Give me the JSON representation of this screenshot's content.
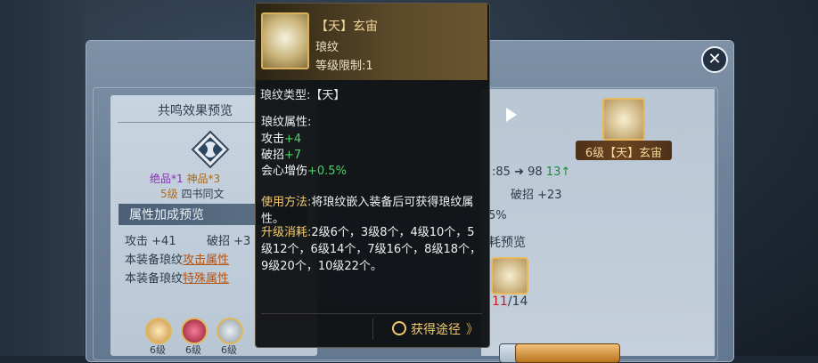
{
  "window": {
    "close_glyph": "✕"
  },
  "resonance": {
    "title": "共鸣效果预览",
    "quality_a": "绝品*1",
    "quality_b": "神品*3",
    "level_prefix": "5级",
    "level_name": "四书同文"
  },
  "attr_preview": {
    "title": "属性加成预览",
    "atk_label": "攻击",
    "atk_value": "+41",
    "brk_label": "破招",
    "brk_value": "+3",
    "equip_row1_prefix": "本装备琅纹",
    "equip_row1_link": "攻击属性",
    "equip_row2_prefix": "本装备琅纹",
    "equip_row2_link": "特殊属性"
  },
  "gem_slots": [
    {
      "level": "6级",
      "icon": "gold-gem-icon"
    },
    {
      "level": "6级",
      "icon": "red-gem-icon"
    },
    {
      "level": "6级",
      "icon": "silver-gem-icon"
    }
  ],
  "upgrade_target": {
    "name": "6级【天】玄宙",
    "stat_from": ":85",
    "stat_to": "98",
    "stat_delta": "13",
    "brk_text": "破招 +23",
    "pct_text": "5%",
    "consume_title": "耗预览",
    "consume_have": "11",
    "consume_need": "/14"
  },
  "tooltip": {
    "name": "【天】玄宙",
    "type": "琅纹",
    "level_limit": "等级限制:1",
    "cut_text": "琅纹类型:【天】",
    "attr_title": "琅纹属性:",
    "atk_label": "攻击",
    "atk_value": "+4",
    "brk_label": "破招",
    "brk_value": "+7",
    "crit_label": "会心增伤",
    "crit_value": "+0.5%",
    "usage_label": "使用方法:",
    "usage_text": "将琅纹嵌入装备后可获得琅纹属性。",
    "upgrade_label": "升级消耗:",
    "upgrade_text": "2级6个，3级8个，4级10个，5级12个，6级14个，7级16个，8级18个，9级20个，10级22个。",
    "obtain_label": "获得途径",
    "obtain_arrow": "》"
  },
  "colors": {
    "accent_gold": "#f3c96b",
    "buff_green": "#4fd16a",
    "warn_red": "#c81c1c"
  }
}
